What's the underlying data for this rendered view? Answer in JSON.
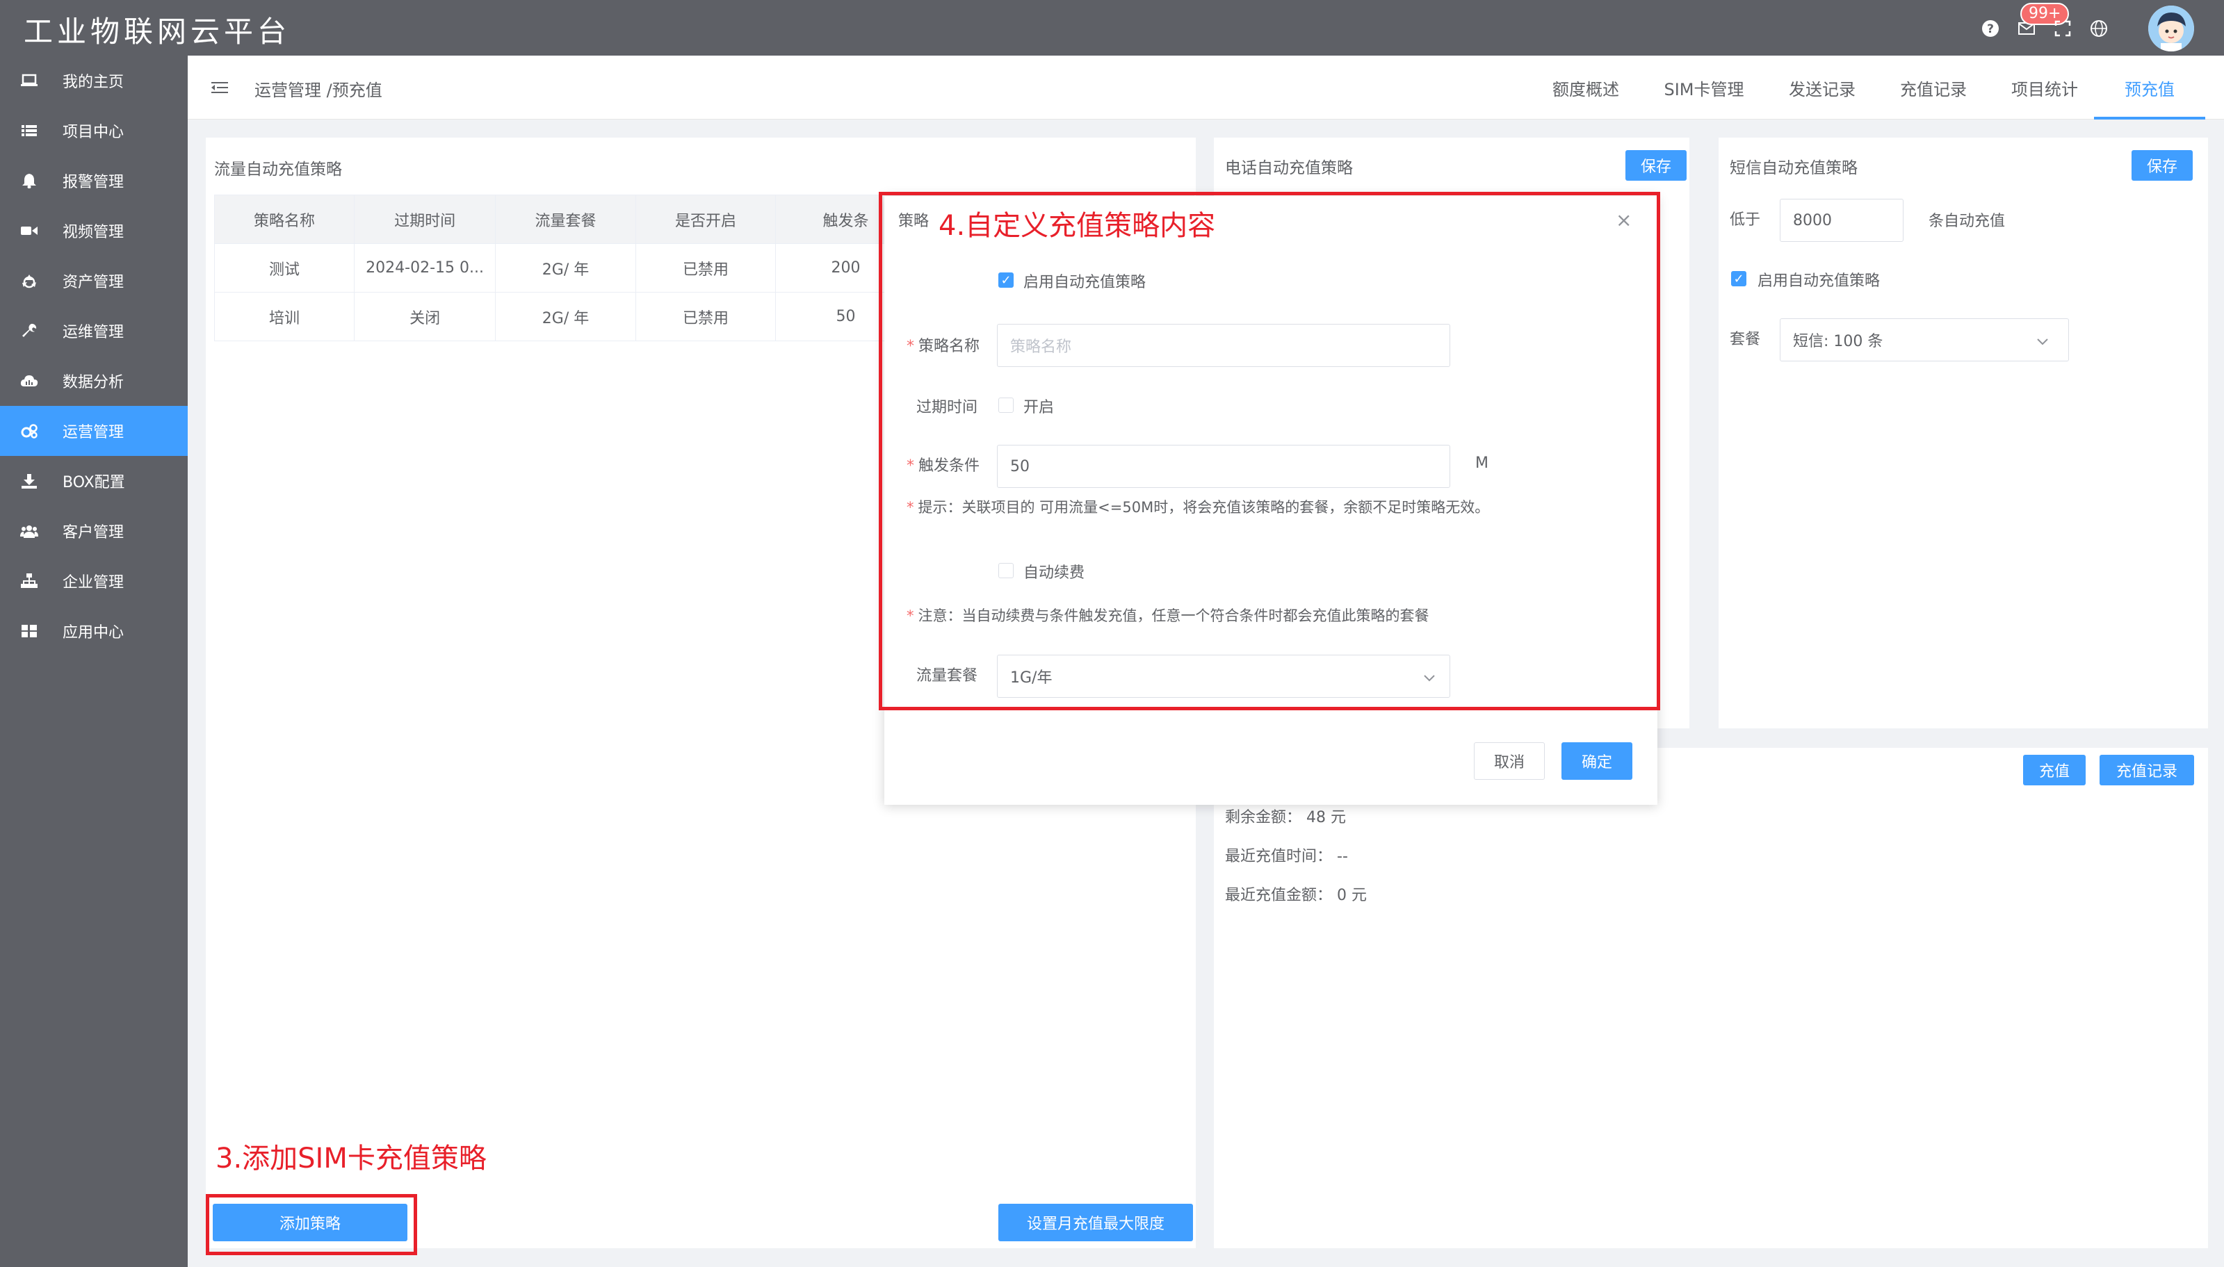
{
  "app": {
    "title": "工业物联网云平台"
  },
  "topbar": {
    "badge": "99+",
    "icons": [
      "help-icon",
      "mail-icon",
      "fullscreen-icon",
      "globe-icon",
      "avatar"
    ]
  },
  "sidebar": {
    "items": [
      {
        "label": "我的主页",
        "icon": "monitor-icon"
      },
      {
        "label": "项目中心",
        "icon": "list-icon"
      },
      {
        "label": "报警管理",
        "icon": "bell-icon"
      },
      {
        "label": "视频管理",
        "icon": "video-icon"
      },
      {
        "label": "资产管理",
        "icon": "recycle-icon"
      },
      {
        "label": "运维管理",
        "icon": "wrench-icon"
      },
      {
        "label": "数据分析",
        "icon": "cloud-chart-icon"
      },
      {
        "label": "运营管理",
        "icon": "cogs-icon"
      },
      {
        "label": "BOX配置",
        "icon": "download-icon"
      },
      {
        "label": "客户管理",
        "icon": "users-icon"
      },
      {
        "label": "企业管理",
        "icon": "sitemap-icon"
      },
      {
        "label": "应用中心",
        "icon": "grid-icon"
      }
    ],
    "active_index": 7
  },
  "header": {
    "breadcrumb": "运营管理 /预充值",
    "tabs": [
      "额度概述",
      "SIM卡管理",
      "发送记录",
      "充值记录",
      "项目统计",
      "预充值"
    ],
    "active_tab": "预充值"
  },
  "flow_panel": {
    "title": "流量自动充值策略",
    "columns": [
      "策略名称",
      "过期时间",
      "流量套餐",
      "是否开启",
      "触发条"
    ],
    "rows": [
      [
        "测试",
        "2024-02-15 0...",
        "2G/ 年",
        "已禁用",
        "200"
      ],
      [
        "培训",
        "关闭",
        "2G/ 年",
        "已禁用",
        "50"
      ]
    ],
    "add_button": "添加策略",
    "monthly_limit_button": "设置月充值最大限度"
  },
  "phone_panel": {
    "title": "电话自动充值策略",
    "save_button": "保存"
  },
  "sms_panel": {
    "title": "短信自动充值策略",
    "save_button": "保存",
    "below_label": "低于",
    "below_value": "8000",
    "below_suffix": "条自动充值",
    "enable_label": "启用自动充值策略",
    "package_label": "套餐",
    "package_value": "短信: 100 条"
  },
  "balance_panel": {
    "recharge_button": "充值",
    "records_button": "充值记录",
    "remaining_label": "剩余金额：",
    "remaining_value": "48 元",
    "last_time_label": "最近充值时间：",
    "last_time_value": "--",
    "last_amount_label": "最近充值金额：",
    "last_amount_value": "0 元"
  },
  "modal": {
    "title": "策略",
    "enable_label": "启用自动充值策略",
    "name_label": "策略名称",
    "name_placeholder": "策略名称",
    "expire_label": "过期时间",
    "expire_option": "开启",
    "trigger_label": "触发条件",
    "trigger_value": "50",
    "trigger_unit": "M",
    "hint": "提示：关联项目的 可用流量<=50M时，将会充值该策略的套餐，余额不足时策略无效。",
    "auto_renew_label": "自动续费",
    "note": "注意：当自动续费与条件触发充值，任意一个符合条件时都会充值此策略的套餐",
    "package_label": "流量套餐",
    "package_value": "1G/年",
    "cancel_button": "取消",
    "confirm_button": "确定"
  },
  "annotations": {
    "step3": "3.添加SIM卡充值策略",
    "step4": "4.自定义充值策略内容",
    "color": "#e8202a"
  },
  "colors": {
    "primary": "#409eff",
    "topbar": "#5e6066",
    "danger": "#f56c6c"
  }
}
